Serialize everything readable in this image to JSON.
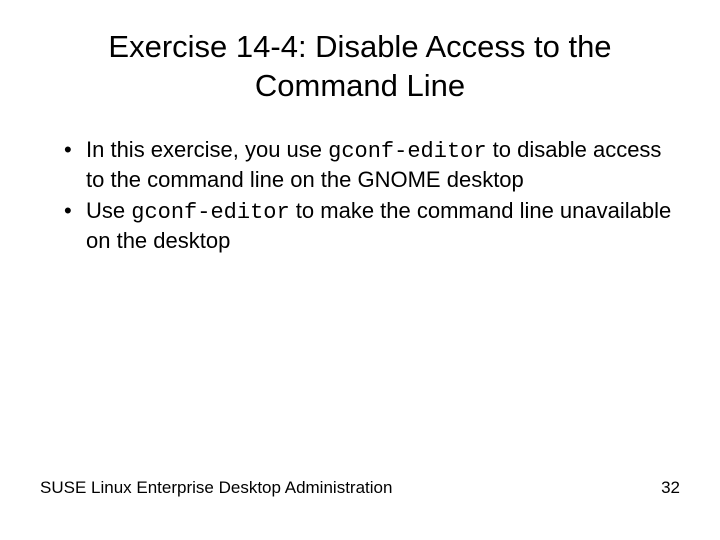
{
  "title": "Exercise 14-4: Disable Access to the Command Line",
  "bullet1": {
    "pre": "In this exercise, you use ",
    "code": "gconf-editor",
    "post": " to disable access to the command line on the GNOME desktop"
  },
  "bullet2": {
    "pre": "Use ",
    "code": "gconf-editor",
    "post": " to make the command line unavailable on the desktop"
  },
  "footer": {
    "left": "SUSE Linux Enterprise Desktop Administration",
    "page": "32"
  }
}
